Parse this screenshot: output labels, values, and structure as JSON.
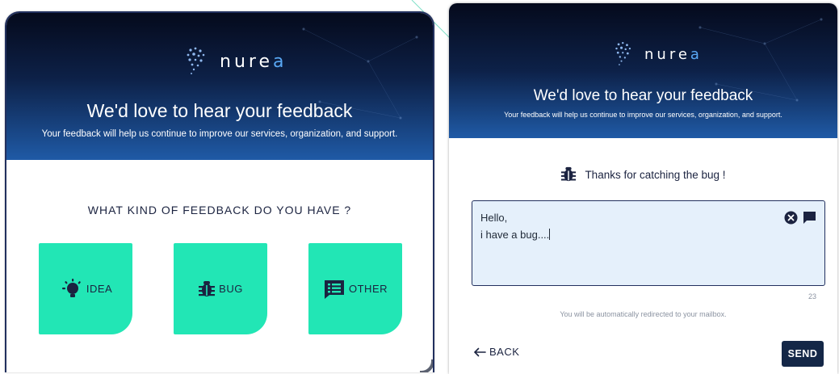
{
  "colors": {
    "navy": "#142747",
    "accent_green": "#22e6b5",
    "logo_blue": "#59a8f5",
    "textarea_bg": "#e5f0fb"
  },
  "left_screen": {
    "logo": {
      "text_main": "nure",
      "text_last": "a"
    },
    "hero_title": "We'd love to hear your feedback",
    "hero_subtitle": "Your feedback will help us continue to improve our services, organization, and support.",
    "question": "WHAT KIND OF FEEDBACK DO YOU HAVE ?",
    "options": [
      {
        "label": "IDEA",
        "icon": "lightbulb-icon"
      },
      {
        "label": "BUG",
        "icon": "bug-icon"
      },
      {
        "label": "OTHER",
        "icon": "feedback-list-icon"
      }
    ]
  },
  "right_screen": {
    "logo": {
      "text_main": "nure",
      "text_last": "a"
    },
    "hero_title": "We'd love to hear your feedback",
    "hero_subtitle": "Your feedback will help us continue to improve our services, organization, and support.",
    "thanks_message": "Thanks for catching the bug !",
    "message": {
      "line1": "Hello,",
      "line2": "i have a bug...."
    },
    "char_count": "23",
    "redirect_note": "You will be automatically redirected to your mailbox.",
    "back_label": "BACK",
    "send_label": "SEND"
  }
}
